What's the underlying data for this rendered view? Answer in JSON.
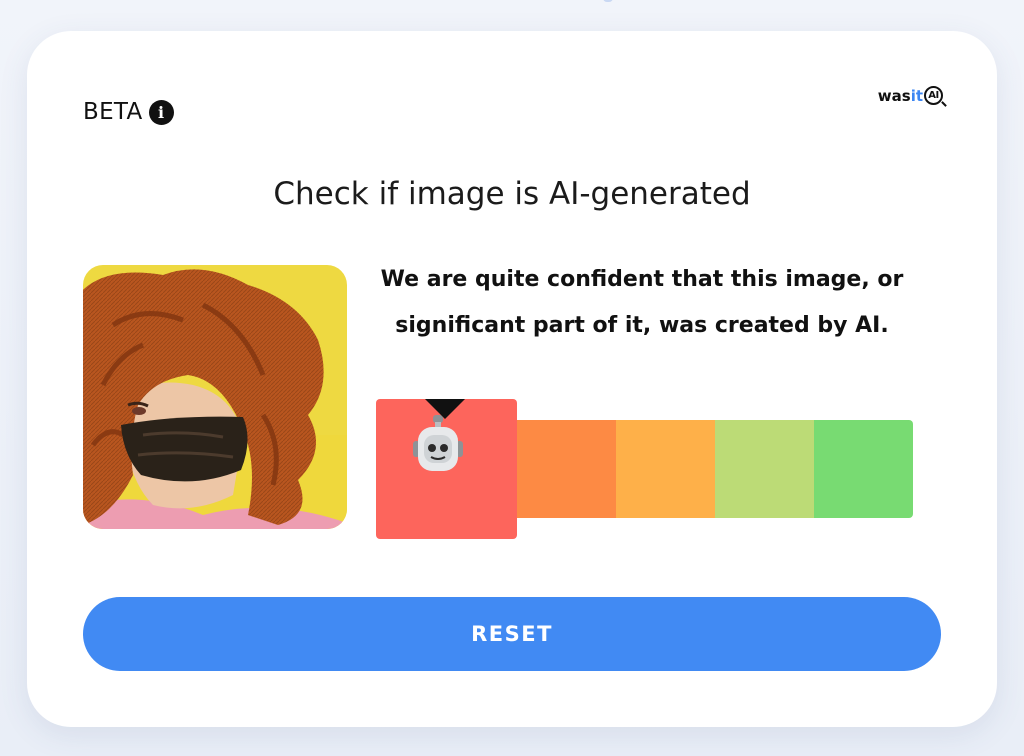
{
  "header": {
    "beta_label": "BETA",
    "info_icon": "info-icon",
    "brand": {
      "prefix": "was",
      "highlight": "it",
      "badge": "AI"
    }
  },
  "main": {
    "title": "Check if image is AI-generated",
    "verdict_line1": "We are quite confident that this image, or",
    "verdict_line2": "significant part of it, was created by AI.",
    "image": {
      "subject": "uploaded-image-thumbnail"
    },
    "meter": {
      "active_index": 0,
      "active_icon": "robot-face-icon",
      "segments": [
        {
          "color": "#fd655c"
        },
        {
          "color": "#fd8a44"
        },
        {
          "color": "#feb049"
        },
        {
          "color": "#bcdb76"
        },
        {
          "color": "#78db72"
        }
      ]
    },
    "reset_label": "RESET"
  },
  "colors": {
    "accent": "#418af3",
    "brand_highlight": "#3c86f2",
    "background": "#eef2f9"
  }
}
